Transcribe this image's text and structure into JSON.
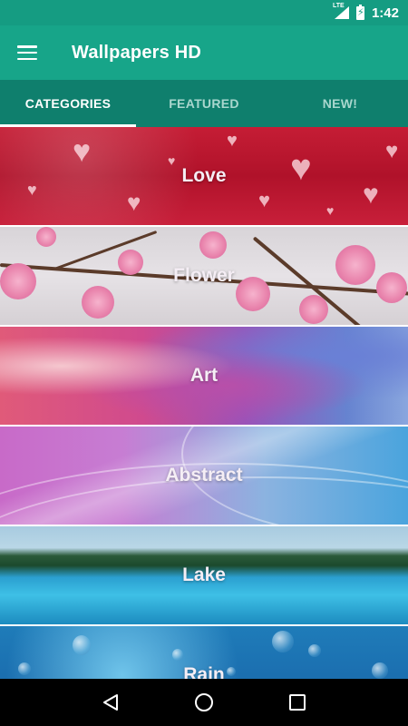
{
  "status_bar": {
    "network": "LTE",
    "time": "1:42",
    "icons": [
      "lte-signal-icon",
      "battery-charging-icon"
    ]
  },
  "app_bar": {
    "title": "Wallpapers HD",
    "menu_icon": "hamburger-menu-icon"
  },
  "tabs": [
    {
      "label": "CATEGORIES",
      "active": true
    },
    {
      "label": "FEATURED",
      "active": false
    },
    {
      "label": "NEW!",
      "active": false
    }
  ],
  "categories": [
    {
      "label": "Love"
    },
    {
      "label": "Flower"
    },
    {
      "label": "Art"
    },
    {
      "label": "Abstract"
    },
    {
      "label": "Lake"
    },
    {
      "label": "Rain"
    }
  ],
  "nav_bar": {
    "icons": [
      "back-icon",
      "home-icon",
      "recents-icon"
    ]
  },
  "colors": {
    "primary": "#17a589",
    "primary_dark": "#159c82",
    "tab_bar": "#0f7f6d",
    "tab_inactive_text": "#a9d7ce"
  }
}
